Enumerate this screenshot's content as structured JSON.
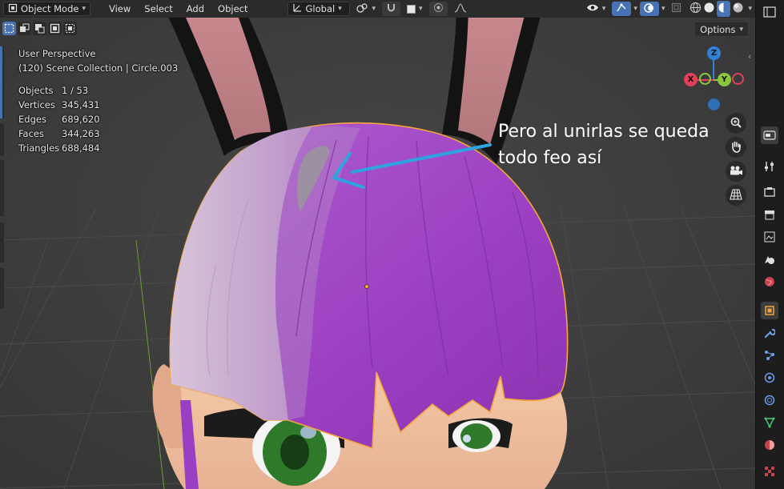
{
  "header": {
    "mode_label": "Object Mode",
    "menus": [
      "View",
      "Select",
      "Add",
      "Object"
    ],
    "orientation_label": "Global"
  },
  "toolbar": {
    "options_label": "Options"
  },
  "overlay": {
    "perspective": "User Perspective",
    "collection": "(120) Scene Collection | Circle.003",
    "stats": [
      {
        "label": "Objects",
        "value": "1 / 53"
      },
      {
        "label": "Vertices",
        "value": "345,431"
      },
      {
        "label": "Edges",
        "value": "689,620"
      },
      {
        "label": "Faces",
        "value": "344,263"
      },
      {
        "label": "Triangles",
        "value": "688,484"
      }
    ]
  },
  "annotation": {
    "line1": "Pero al unirlas se queda",
    "line2": "todo feo así"
  },
  "gizmo": {
    "z_label": "Z",
    "x_label": "X",
    "y_label": "Y",
    "x_color": "#e0405a",
    "y_color": "#8cc63e",
    "z_color": "#2f83d6"
  },
  "colors": {
    "accent": "#4772b3",
    "selection_outline": "#f5a53b",
    "hair": "#a049c4",
    "annotation_arrow": "#2ea3e0"
  },
  "icons": {
    "mode": "object-mode-icon",
    "orientation": "transform-orientation-icon",
    "snap": "magnet-icon",
    "proportional": "proportional-editing-icon",
    "visibility": "eye-icon",
    "gizmo": "gizmo-icon",
    "overlays": "overlays-icon",
    "xray": "xray-icon",
    "shading": [
      "wireframe-icon",
      "solid-icon",
      "material-preview-icon",
      "rendered-icon"
    ],
    "nav": [
      "zoom-icon",
      "hand-icon",
      "camera-icon",
      "grid-icon"
    ]
  }
}
